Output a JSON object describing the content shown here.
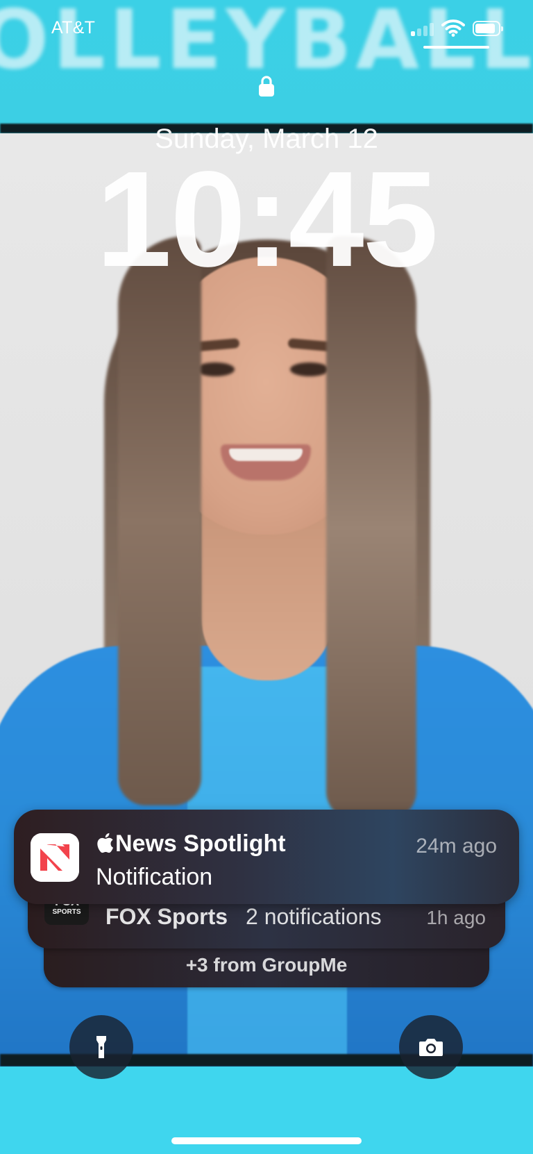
{
  "status_bar": {
    "carrier": "AT&T",
    "signal_icon": "cellular-signal-icon",
    "wifi_icon": "wifi-icon",
    "battery_icon": "battery-icon"
  },
  "lock_screen": {
    "lock_icon": "lock-icon",
    "date": "Sunday, March 12",
    "time": "10:45"
  },
  "notifications": {
    "primary": {
      "app_icon": "apple-news-icon",
      "app_name": "News Spotlight",
      "body": "Notification",
      "time": "24m ago"
    },
    "secondary": {
      "app_icon": "fox-sports-icon",
      "app_name": "FOX Sports",
      "count": "2 notifications",
      "time": "1h ago"
    },
    "more": {
      "label": "+3 from GroupMe"
    }
  },
  "quick_actions": {
    "flashlight": "flashlight-icon",
    "camera": "camera-icon"
  },
  "colors": {
    "banner": "#3fd6ec",
    "notification_bg": "#2e3142",
    "jersey_blue": "#2d8fe0"
  }
}
